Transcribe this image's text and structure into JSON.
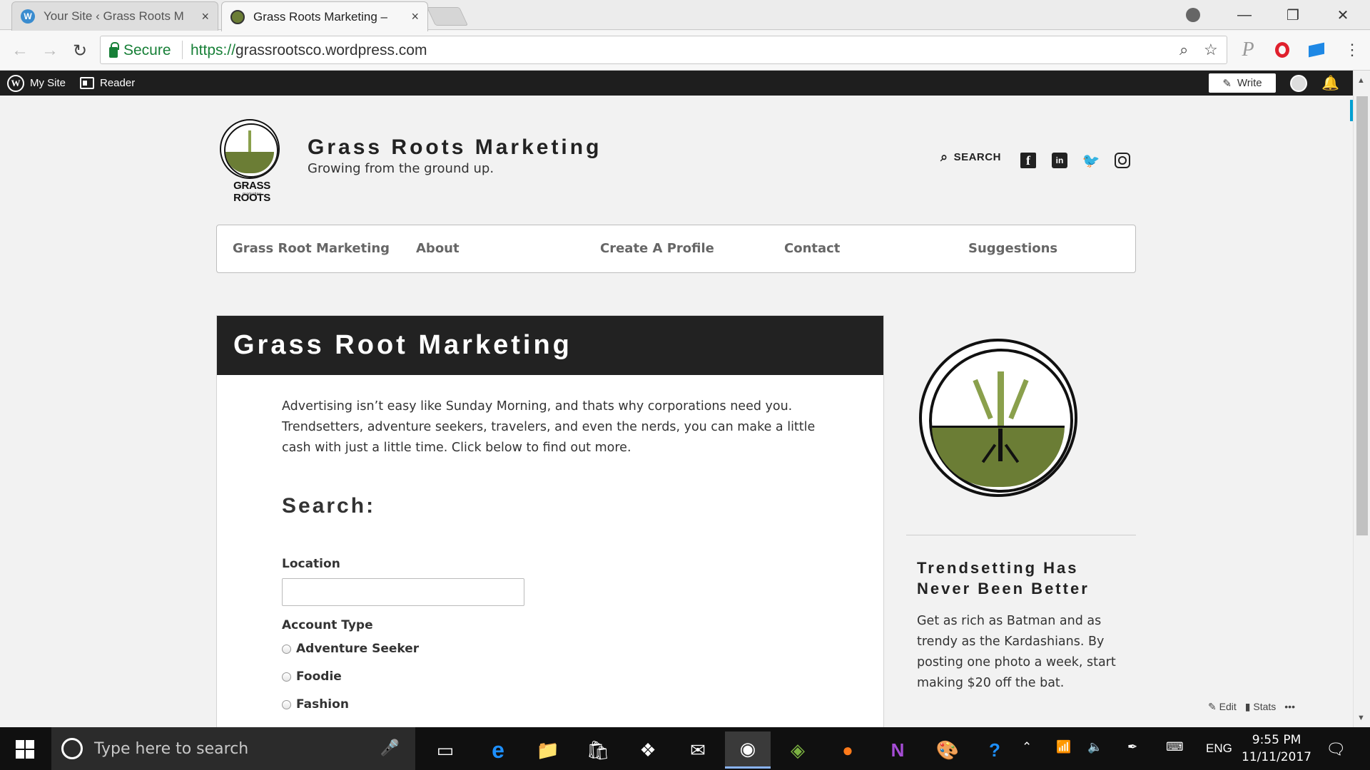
{
  "browser": {
    "tabs": [
      {
        "title": "Your Site ‹ Grass Roots M",
        "close": "×"
      },
      {
        "title": "Grass Roots Marketing –",
        "close": "×"
      }
    ],
    "secure_label": "Secure",
    "url_protocol": "https://",
    "url_host": "grassrootsco.wordpress.com"
  },
  "wpbar": {
    "my_site": "My Site",
    "reader": "Reader",
    "write": "Write"
  },
  "site": {
    "logo_text": "GRASS ROOTS",
    "logo_subtext": "marketing",
    "title": "Grass Roots Marketing",
    "tagline": "Growing from the ground up.",
    "search_label": "SEARCH",
    "social": {
      "facebook": "f",
      "linkedin": "in",
      "twitter": "🐦"
    }
  },
  "nav": {
    "items": [
      "Grass Root Marketing",
      "About",
      "Create A Profile",
      "Contact",
      "Suggestions"
    ]
  },
  "page": {
    "heading": "Grass Root Marketing",
    "intro": "Advertising isn’t easy like Sunday Morning, and thats why corporations need you. Trendsetters, adventure seekers, travelers, and even the nerds, you can make a little cash with just a little time. Click below to find out more.",
    "search_heading": "Search:",
    "location_label": "Location",
    "location_value": "",
    "account_type_label": "Account Type",
    "account_types": [
      "Adventure Seeker",
      "Foodie",
      "Fashion"
    ]
  },
  "sidebar": {
    "widget_title": "Trendsetting Has Never Been Better",
    "widget_text": "Get as rich as Batman and as trendy as the Kardashians. By posting one photo a week, start making $20 off the bat."
  },
  "editbar": {
    "edit": "Edit",
    "stats": "Stats",
    "more": "•••"
  },
  "taskbar": {
    "search_placeholder": "Type here to search",
    "language": "ENG",
    "time": "9:55 PM",
    "date": "11/11/2017"
  },
  "colors": {
    "secure_green": "#188038",
    "admin_bar": "#1e1e1e",
    "logo_soil": "#6b7d35",
    "logo_grass": "#8aa04c"
  }
}
